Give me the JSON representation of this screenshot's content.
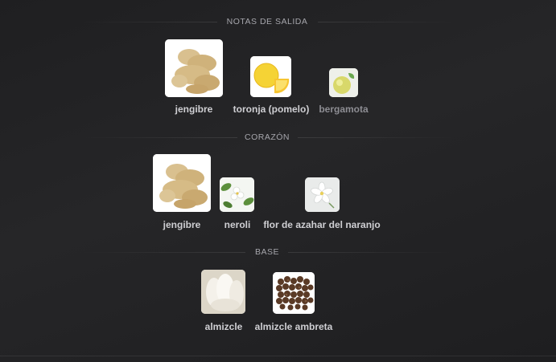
{
  "sections": {
    "top": {
      "title": "NOTAS DE SALIDA",
      "notes": [
        {
          "label": "jengibre",
          "icon": "ginger-icon"
        },
        {
          "label": "toronja (pomelo)",
          "icon": "grapefruit-icon"
        },
        {
          "label": "bergamota",
          "icon": "bergamot-icon"
        }
      ]
    },
    "heart": {
      "title": "CORAZÓN",
      "notes": [
        {
          "label": "jengibre",
          "icon": "ginger-icon"
        },
        {
          "label": "neroli",
          "icon": "neroli-flower-icon"
        },
        {
          "label": "flor de azahar del naranjo",
          "icon": "orange-blossom-icon"
        }
      ]
    },
    "base": {
      "title": "BASE",
      "notes": [
        {
          "label": "almizcle",
          "icon": "musk-icon"
        },
        {
          "label": "almizcle ambreta",
          "icon": "ambrette-seeds-icon"
        }
      ]
    }
  },
  "colors": {
    "background": "#232325",
    "label": "#cfcfd3",
    "label_dim": "#8d8d93",
    "section_title": "#a6a6ac"
  }
}
